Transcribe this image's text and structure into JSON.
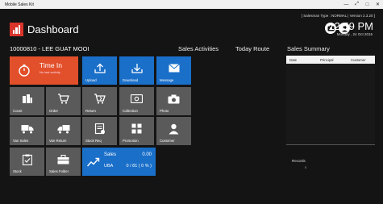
{
  "window": {
    "title": "Mobile Sales Kit"
  },
  "header": {
    "title": "Dashboard",
    "user_info": "[ Salesman Type : NORMAL | Version 2.3.20 ]",
    "time": "12:59 PM",
    "date": "Monday , 24 Oct 2016"
  },
  "customer": "10000810 - LEE GUAT MOOI",
  "sections": {
    "activities": "Sales Activities",
    "route": "Today Route",
    "summary": "Sales Summary"
  },
  "tiles": {
    "time_in": {
      "title": "Time In",
      "subtitle": "No last activity"
    },
    "upload": "Upload",
    "download": "Download",
    "message": "Message",
    "count": "Count",
    "order": "Order",
    "return": "Return",
    "collection": "Collection",
    "photo": "Photo",
    "van_sales": "Van Sales",
    "van_return": "Van Return",
    "stock_req": "Stock Req",
    "promotion": "Promotion",
    "customer": "Customer",
    "stock": "Stock",
    "sales_folder": "Sales Folder",
    "sales": {
      "label": "Sales",
      "amount": "0.00",
      "uba_label": "UBA",
      "uba_value": "0 / 81 ( 0 % )"
    }
  },
  "summary": {
    "columns": [
      "Date",
      "Principal",
      "Customer"
    ],
    "records_label": "Records",
    "records_value": "0"
  },
  "colors": {
    "red": "#e24f2b",
    "blue": "#1a6fc9",
    "gray": "#5a5a5a"
  }
}
